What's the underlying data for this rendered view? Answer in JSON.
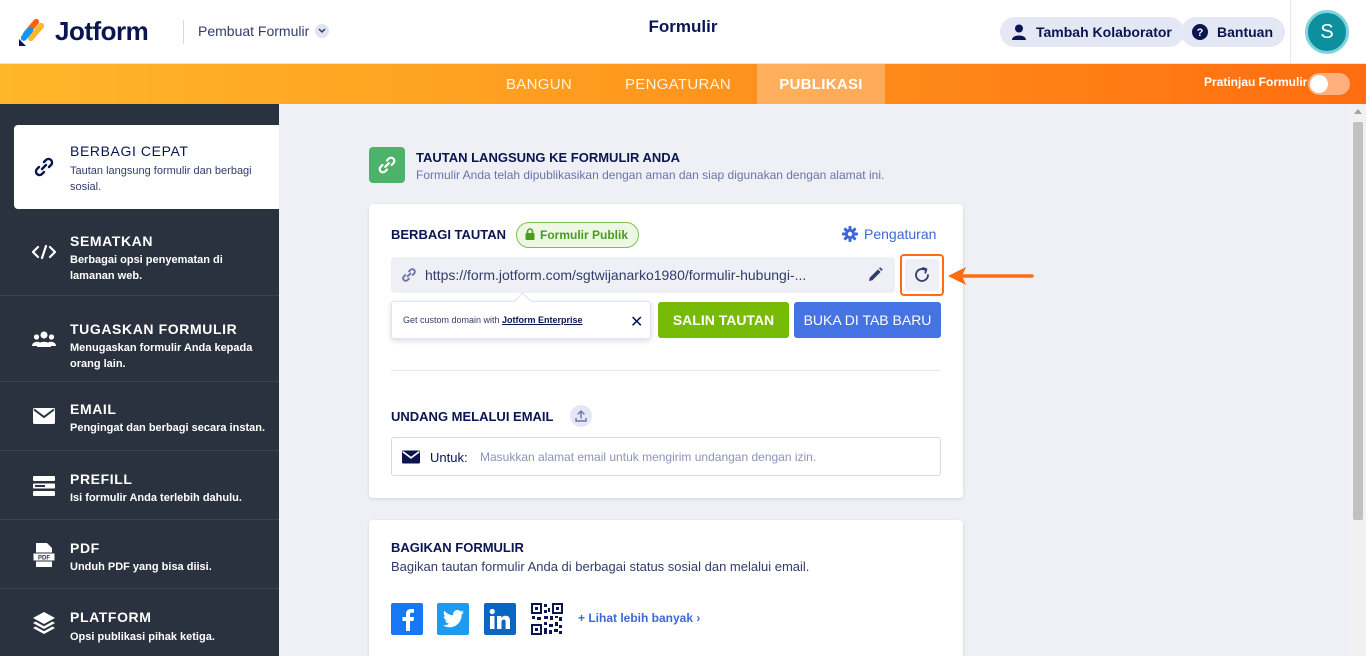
{
  "header": {
    "logo_text": "Jotform",
    "builder_menu": "Pembuat Formulir",
    "title": "Formulir",
    "collaborator_button": "Tambah Kolaborator",
    "help_button": "Bantuan",
    "avatar_initial": "S"
  },
  "nav": {
    "tabs": [
      "BANGUN",
      "PENGATURAN",
      "PUBLIKASI"
    ],
    "active_tab": "PUBLIKASI",
    "preview_label": "Pratinjau Formulir"
  },
  "sidebar": {
    "items": [
      {
        "title": "BERBAGI CEPAT",
        "desc": "Tautan langsung formulir dan berbagi sosial."
      },
      {
        "title": "SEMATKAN",
        "desc": "Berbagai opsi penyematan di lamanan web."
      },
      {
        "title": "TUGASKAN FORMULIR",
        "desc": "Menugaskan formulir Anda kepada orang lain."
      },
      {
        "title": "EMAIL",
        "desc": "Pengingat dan berbagi secara instan."
      },
      {
        "title": "PREFILL",
        "desc": "Isi formulir Anda terlebih dahulu."
      },
      {
        "title": "PDF",
        "desc": "Unduh PDF yang bisa diisi."
      },
      {
        "title": "PLATFORM",
        "desc": "Opsi publikasi pihak ketiga."
      }
    ]
  },
  "main": {
    "heading": "TAUTAN LANGSUNG KE FORMULIR ANDA",
    "subheading": "Formulir Anda telah dipublikasikan dengan aman dan siap digunakan dengan alamat ini.",
    "share_link": {
      "label": "BERBAGI TAUTAN",
      "badge": "Formulir Publik",
      "settings": "Pengaturan",
      "url": "https://form.jotform.com/sgtwijanarko1980/formulir-hubungi-...",
      "tooltip_text": "Get custom domain with ",
      "tooltip_link": "Jotform Enterprise",
      "tooltip_close": "✕",
      "copy_button": "SALIN TAUTAN",
      "open_button": "BUKA DI TAB BARU"
    },
    "email_invite": {
      "label": "UNDANG MELALUI EMAIL",
      "to_label": "Untuk:",
      "placeholder": "Masukkan alamat email untuk mengirim undangan dengan izin."
    },
    "share_form": {
      "label": "BAGIKAN FORMULIR",
      "desc": "Bagikan tautan formulir Anda di berbagai status sosial dan melalui email.",
      "more_link": "+ Lihat lebih banyak ›",
      "social_icons": [
        "facebook-icon",
        "twitter-icon",
        "linkedin-icon",
        "qr-code-icon"
      ]
    }
  },
  "colors": {
    "accent_orange": "#ff6d10",
    "green_button": "#78bb07",
    "blue_button": "#4573e3",
    "sidebar_bg": "#2b323f",
    "facebook": "#1877f2",
    "twitter": "#1d9bf0",
    "linkedin": "#0a66c2"
  }
}
